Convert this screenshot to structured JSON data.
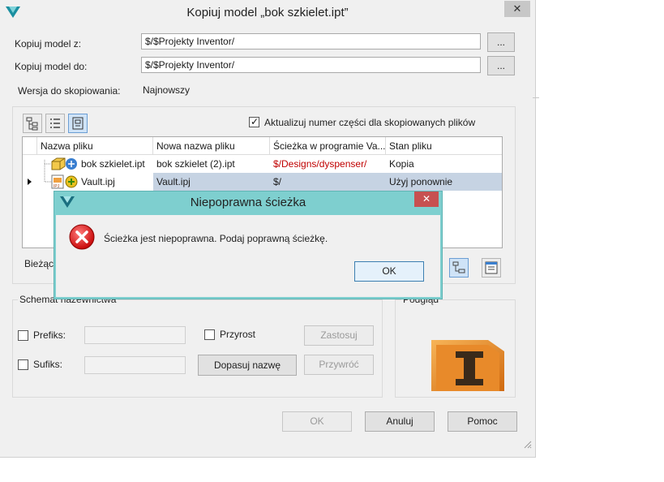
{
  "window": {
    "title": "Kopiuj model „bok szkielet.ipt”",
    "close": "✕"
  },
  "form": {
    "copy_from_label": "Kopiuj model z:",
    "copy_from_value": "$/$Projekty Inventor/",
    "copy_to_label": "Kopiuj model do:",
    "copy_to_value": "$/$Projekty Inventor/",
    "browse_label": "...",
    "version_label": "Wersja do skopiowania:",
    "version_value": "Najnowszy"
  },
  "update_part_number": {
    "label": "Aktualizuj numer części dla skopiowanych plików",
    "checked": true
  },
  "grid": {
    "columns": [
      "Nazwa pliku",
      "Nowa nazwa pliku",
      "Ścieżka w programie Va...",
      "Stan pliku"
    ],
    "rows": [
      {
        "name": "bok szkielet.ipt",
        "new_name": "bok szkielet (2).ipt",
        "path": "$/Designs/dyspenser/",
        "state": "Kopia"
      },
      {
        "name": "Vault.ipj",
        "new_name": "Vault.ipj",
        "path": "$/",
        "state": "Użyj ponownie"
      }
    ]
  },
  "current_label": "Bieżący",
  "naming": {
    "group_label": "Schemat nazewnictwa",
    "prefix_label": "Prefiks:",
    "suffix_label": "Sufiks:",
    "increment_label": "Przyrost",
    "apply_label": "Zastosuj",
    "restore_label": "Przywróć",
    "fit_name_label": "Dopasuj nazwę"
  },
  "preview_label": "Podgląd",
  "footer": {
    "ok": "OK",
    "cancel": "Anuluj",
    "help": "Pomoc"
  },
  "error_dialog": {
    "title": "Niepoprawna ścieżka",
    "message": "Ścieżka jest niepoprawna. Podaj poprawną ścieżkę.",
    "ok": "OK",
    "close": "✕"
  },
  "colors": {
    "error_frame": "#7ecfcf",
    "error_close": "#c75050",
    "path_red": "#c00000",
    "selected_row": "#c6d3e3"
  }
}
